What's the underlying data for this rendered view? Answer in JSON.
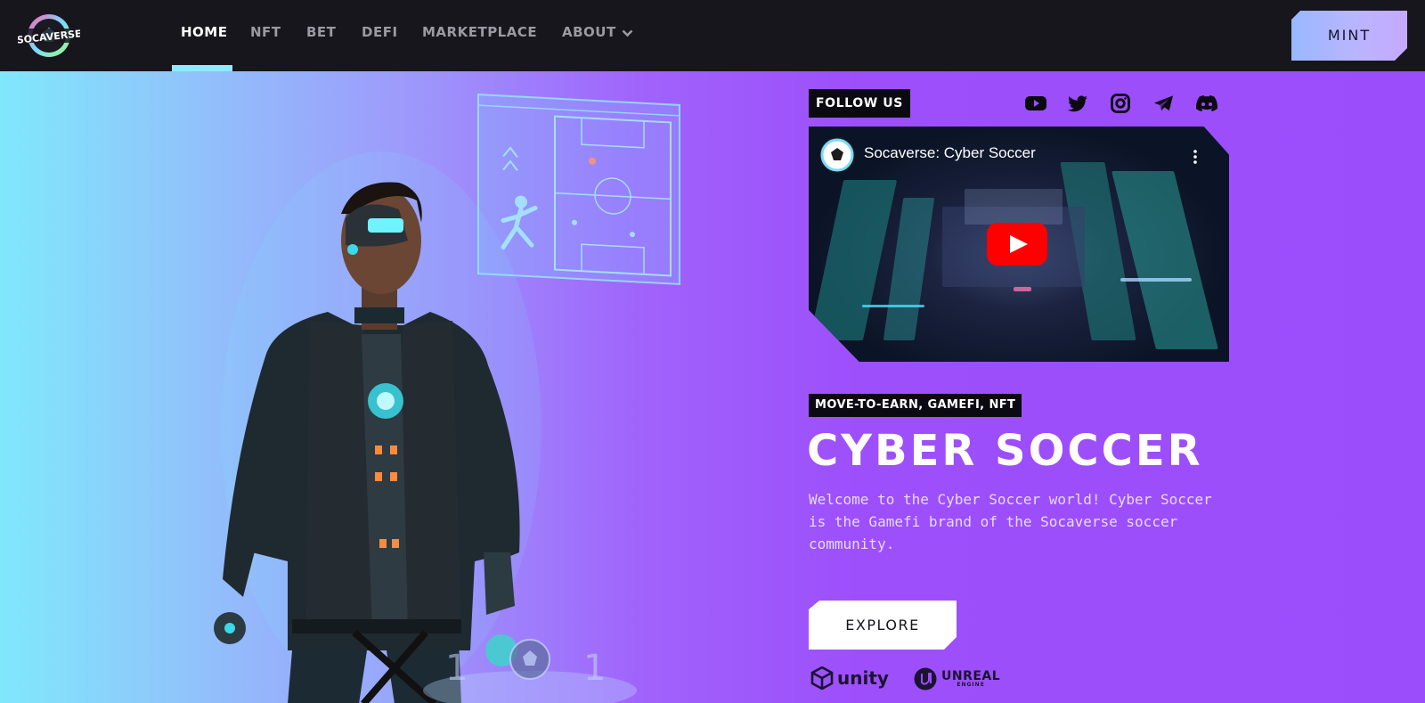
{
  "nav": {
    "logo_text": "SOCAVERSE",
    "items": [
      {
        "label": "HOME",
        "active": true
      },
      {
        "label": "NFT"
      },
      {
        "label": "BET"
      },
      {
        "label": "DEFI"
      },
      {
        "label": "MARKETPLACE"
      },
      {
        "label": "ABOUT",
        "has_dropdown": true
      }
    ],
    "mint_label": "MINT"
  },
  "hero": {
    "follow_label": "FOLLOW US",
    "social_icons": [
      "youtube-icon",
      "twitter-icon",
      "instagram-icon",
      "telegram-icon",
      "discord-icon"
    ],
    "video": {
      "title": "Socaverse: Cyber Soccer"
    },
    "tags": "MOVE-TO-EARN, GAMEFI, NFT",
    "title": "CYBER SOCCER",
    "description": "Welcome to the Cyber Soccer world! Cyber Soccer is the Gamefi brand of the Socaverse soccer community.",
    "explore_label": "EXPLORE",
    "engines": [
      "unity",
      "UNREAL"
    ],
    "engine_sub": "ENGINE",
    "pedestal_numbers": [
      "1",
      "1"
    ]
  },
  "colors": {
    "nav_bg": "#17161c",
    "accent_cyan": "#8fe9ff",
    "purple": "#9b4dfb",
    "youtube_red": "#ff0000"
  }
}
